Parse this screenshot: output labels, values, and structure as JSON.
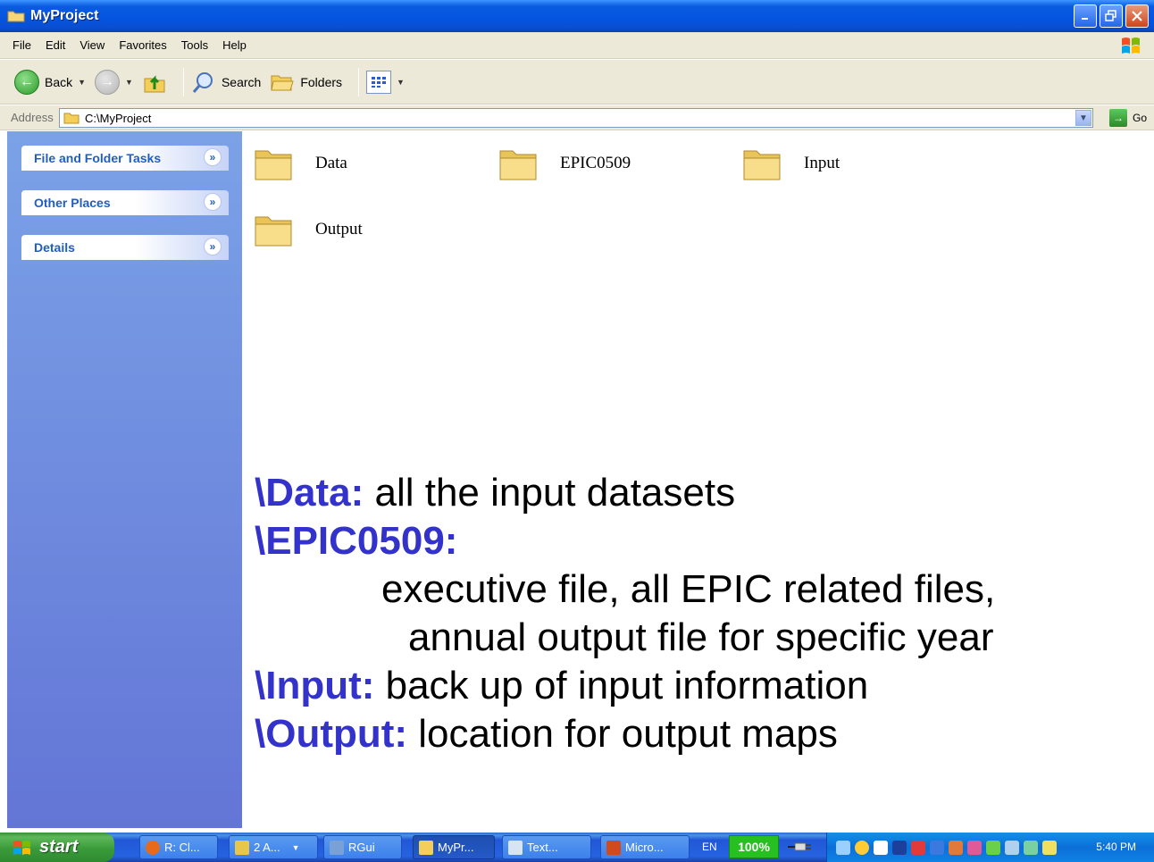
{
  "window": {
    "title": "MyProject",
    "menu": [
      "File",
      "Edit",
      "View",
      "Favorites",
      "Tools",
      "Help"
    ]
  },
  "toolbar": {
    "back_label": "Back",
    "search_label": "Search",
    "folders_label": "Folders"
  },
  "address": {
    "label": "Address",
    "value": "C:\\MyProject",
    "go_label": "Go"
  },
  "taskpane": {
    "groups": [
      "File and Folder Tasks",
      "Other Places",
      "Details"
    ]
  },
  "folders": [
    {
      "name": "Data"
    },
    {
      "name": "EPIC0509"
    },
    {
      "name": "Input"
    },
    {
      "name": "Output"
    }
  ],
  "notes": {
    "data_key": "\\Data:",
    "data_text": " all the input datasets",
    "epic_key": "\\EPIC0509:",
    "epic_line1": "executive file, all EPIC related files,",
    "epic_line2": "annual output file for specific year",
    "input_key": "\\Input:",
    "input_text": " back up of input information",
    "output_key": "\\Output:",
    "output_text": " location for output maps"
  },
  "taskbar": {
    "start_label": "start",
    "buttons": [
      "R: Cl...",
      "2 A...",
      "RGui",
      "MyPr...",
      "Text...",
      "Micro..."
    ],
    "language": "EN",
    "zoom": "100%",
    "clock": "5:40 PM"
  },
  "colors": {
    "titlebar": "#0454e0",
    "taskpane": "#6d8cdd",
    "note_key": "#3333cc",
    "taskbar": "#2459c8",
    "zoom_badge": "#26c020"
  }
}
